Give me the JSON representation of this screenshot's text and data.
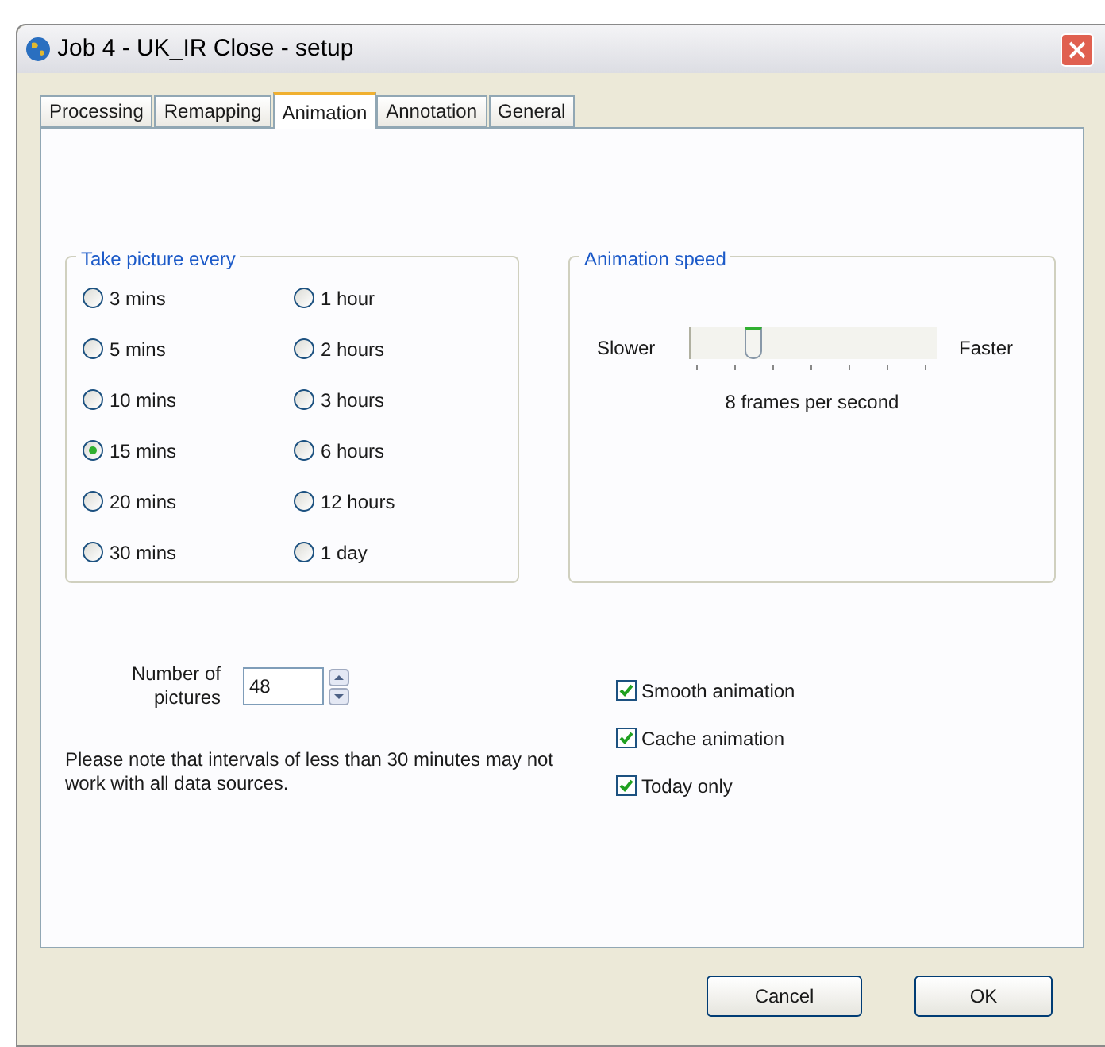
{
  "window": {
    "title": "Job 4 - UK_IR Close - setup"
  },
  "tabs": [
    {
      "label": "Processing",
      "selected": false
    },
    {
      "label": "Remapping",
      "selected": false
    },
    {
      "label": "Animation",
      "selected": true
    },
    {
      "label": "Annotation",
      "selected": false
    },
    {
      "label": "General",
      "selected": false
    }
  ],
  "interval_group": {
    "title": "Take picture every",
    "options": [
      {
        "label": "3 mins",
        "selected": false
      },
      {
        "label": "5 mins",
        "selected": false
      },
      {
        "label": "10 mins",
        "selected": false
      },
      {
        "label": "15 mins",
        "selected": true
      },
      {
        "label": "20 mins",
        "selected": false
      },
      {
        "label": "30 mins",
        "selected": false
      },
      {
        "label": "1 hour",
        "selected": false
      },
      {
        "label": "2 hours",
        "selected": false
      },
      {
        "label": "3 hours",
        "selected": false
      },
      {
        "label": "6 hours",
        "selected": false
      },
      {
        "label": "12 hours",
        "selected": false
      },
      {
        "label": "1 day",
        "selected": false
      }
    ]
  },
  "speed_group": {
    "title": "Animation speed",
    "min_label": "Slower",
    "max_label": "Faster",
    "level": 0.25,
    "reading": "8 frames per second"
  },
  "number_of_pictures": {
    "label": "Number of pictures",
    "value": "48"
  },
  "note": "Please note that intervals of less than 30 minutes may not work with all data sources.",
  "checkboxes": [
    {
      "label": "Smooth animation",
      "checked": true
    },
    {
      "label": "Cache animation",
      "checked": true
    },
    {
      "label": "Today only",
      "checked": true
    }
  ],
  "buttons": [
    "Cancel",
    "OK"
  ]
}
